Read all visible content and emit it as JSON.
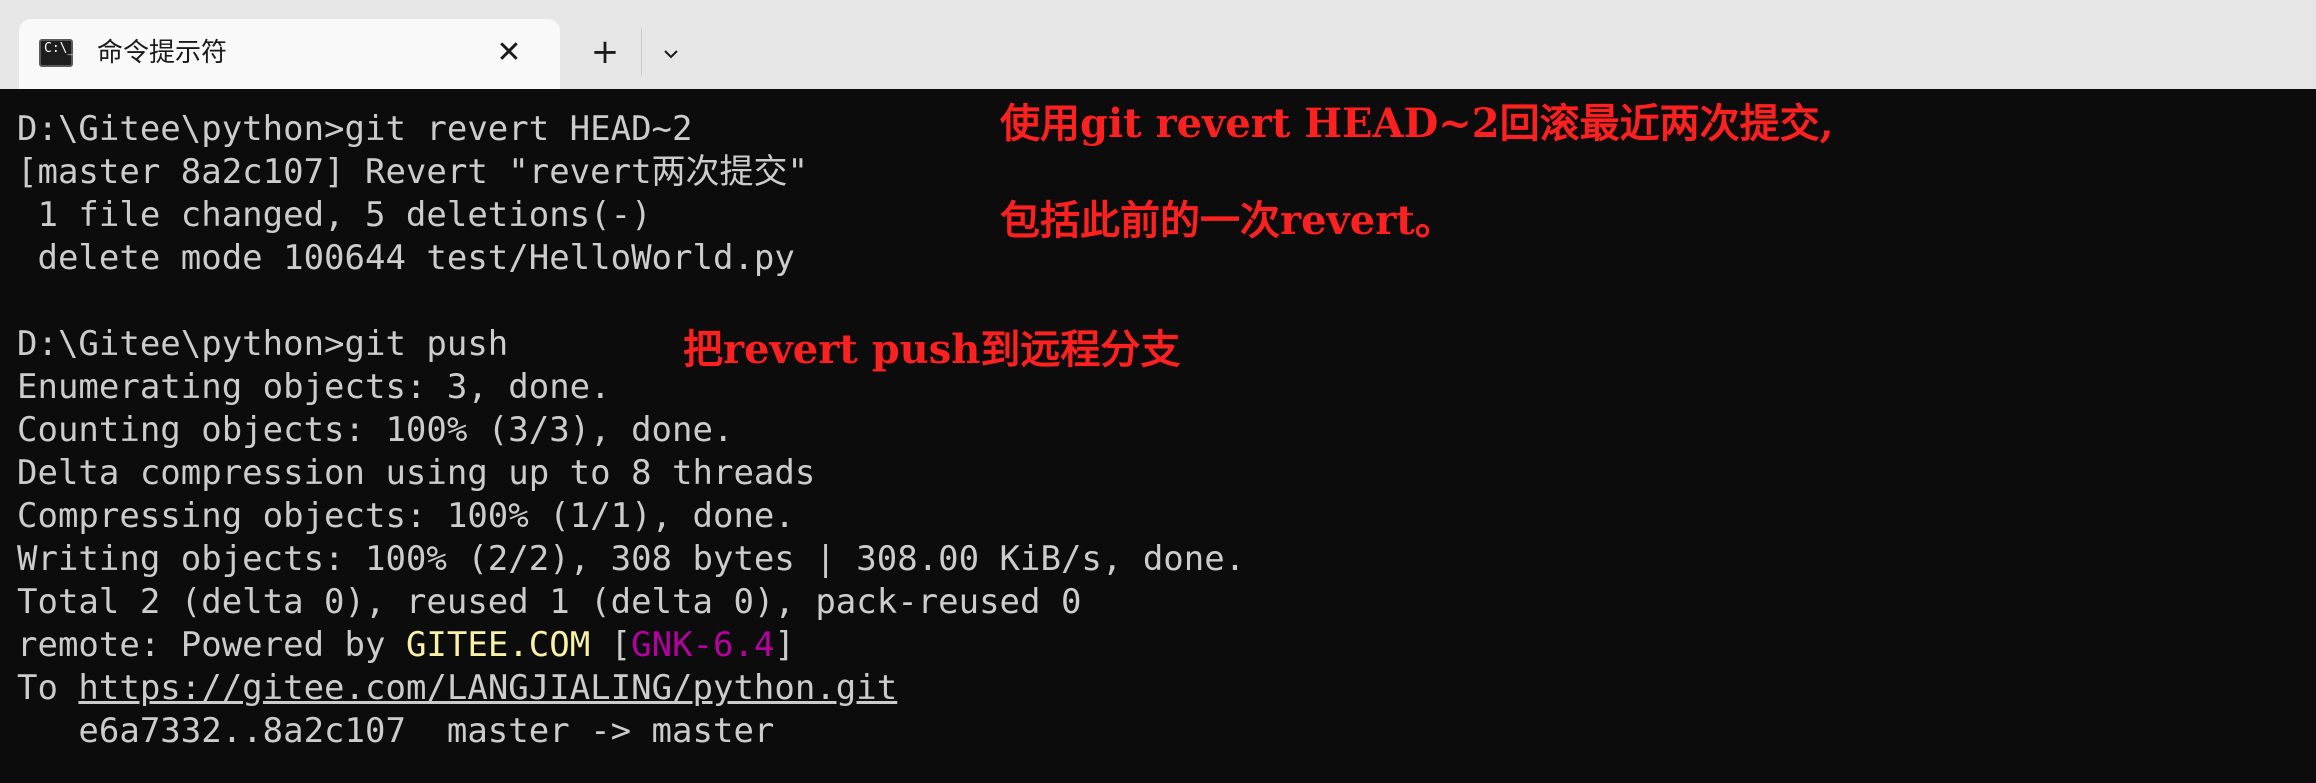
{
  "tab": {
    "icon_text": "C:\\_",
    "title": "命令提示符",
    "close_glyph": "✕",
    "new_tab_glyph": "+",
    "dropdown_icon": "chevron-down-icon"
  },
  "terminal": {
    "l1": "D:\\Gitee\\python>git revert HEAD~2",
    "l2": "[master 8a2c107] Revert \"revert两次提交\"",
    "l3": " 1 file changed, 5 deletions(-)",
    "l4": " delete mode 100644 test/HelloWorld.py",
    "l5": "D:\\Gitee\\python>git push",
    "l6": "Enumerating objects: 3, done.",
    "l7": "Counting objects: 100% (3/3), done.",
    "l8": "Delta compression using up to 8 threads",
    "l9": "Compressing objects: 100% (1/1), done.",
    "l10": "Writing objects: 100% (2/2), 308 bytes | 308.00 KiB/s, done.",
    "l11": "Total 2 (delta 0), reused 1 (delta 0), pack-reused 0",
    "l12_prefix": "remote: Powered by ",
    "l12_site": "GITEE.COM",
    "l12_open": " [",
    "l12_tag": "GNK-6.4",
    "l12_close": "]",
    "l13_prefix": "To ",
    "l13_url": "https://gitee.com/LANGJIALING/python.git",
    "l14": "   e6a7332..8a2c107  master -> master"
  },
  "annotations": {
    "revert_note_1": "使用git revert HEAD~2回滚最近两次提交,",
    "revert_note_2": "包括此前的一次revert。",
    "push_note": "把revert push到远程分支"
  },
  "colors": {
    "background": "#0c0c0c",
    "text": "#cccccc",
    "annotation": "#ff2020",
    "site": "#f9f1a5",
    "tag": "#b4009e"
  }
}
